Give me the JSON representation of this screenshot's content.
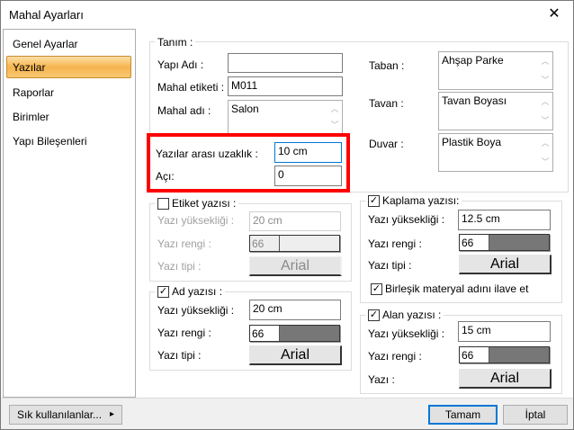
{
  "window": {
    "title": "Mahal Ayarları",
    "close": "✕"
  },
  "sidebar": {
    "items": [
      {
        "label": "Genel Ayarlar"
      },
      {
        "label": "Yazılar"
      },
      {
        "label": "Raporlar"
      },
      {
        "label": "Birimler"
      },
      {
        "label": "Yapı Bileşenleri"
      }
    ],
    "selected": "Yazılar"
  },
  "tanim": {
    "legend": "Tanım :",
    "yapi_adi_label": "Yapı Adı :",
    "yapi_adi": "",
    "mahal_etiketi_label": "Mahal etiketi :",
    "mahal_etiketi": "M011",
    "mahal_adi_label": "Mahal adı :",
    "mahal_adi": "Salon",
    "taban_label": "Taban  :",
    "taban": "Ahşap Parke",
    "tavan_label": "Tavan  :",
    "tavan": "Tavan Boyası",
    "duvar_label": "Duvar  :",
    "duvar": "Plastik Boya",
    "uzaklik_label": "Yazılar arası uzaklık  :",
    "uzaklik": "10 cm",
    "aci_label": "Açı:",
    "aci": "0"
  },
  "etiket": {
    "legend": "Etiket yazısı :",
    "checked": false,
    "h_label": "Yazı yüksekliği :",
    "h": "20 cm",
    "c_label": "Yazı rengi :",
    "c": "66",
    "t_label": "Yazı tipi :",
    "t": "Arial"
  },
  "ad": {
    "legend": "Ad yazısı :",
    "checked": true,
    "h_label": "Yazı yüksekliği :",
    "h": "20 cm",
    "c_label": "Yazı rengi :",
    "c": "66",
    "t_label": "Yazı tipi :",
    "t": "Arial"
  },
  "kaplama": {
    "legend": "Kaplama yazısı:",
    "checked": true,
    "h_label": "Yazı yüksekliği :",
    "h": "12.5 cm",
    "c_label": "Yazı rengi :",
    "c": "66",
    "t_label": "Yazı tipi :",
    "t": "Arial",
    "birlesik_label": "Birleşik materyal adını ilave et",
    "birlesik": true
  },
  "alan": {
    "legend": "Alan yazısı :",
    "checked": true,
    "h_label": "Yazı yüksekliği :",
    "h": "15 cm",
    "c_label": "Yazı rengi :",
    "c": "66",
    "t_label": "Yazı :",
    "t": "Arial"
  },
  "footer": {
    "favorites": "Sık kullanılanlar...",
    "favorites_arrow": "▸",
    "ok": "Tamam",
    "cancel": "İptal"
  },
  "check": "✓",
  "colors": {
    "swatch": "#777777",
    "highlight": "#f00000"
  }
}
